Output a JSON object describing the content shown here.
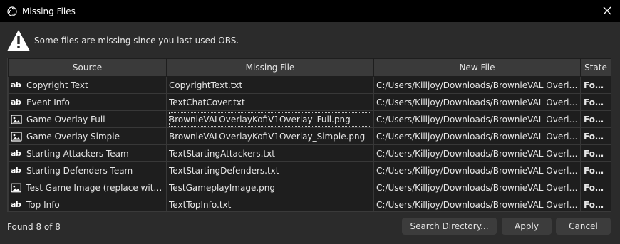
{
  "window": {
    "title": "Missing Files",
    "close_icon": "close-icon"
  },
  "warning": {
    "icon": "warning-icon",
    "text": "Some files are missing since you last used OBS."
  },
  "table": {
    "headers": [
      "Source",
      "Missing File",
      "New File",
      "State"
    ],
    "rows": [
      {
        "type": "text",
        "source": "Copyright Text",
        "missing": "CopyrightText.txt",
        "new": "C:/Users/Killjoy/Downloads/BrownieVAL Overlays K...",
        "state": "Found"
      },
      {
        "type": "text",
        "source": "Event Info",
        "missing": "TextChatCover.txt",
        "new": "C:/Users/Killjoy/Downloads/BrownieVAL Overlays K...",
        "state": "Found"
      },
      {
        "type": "image",
        "source": "Game Overlay Full",
        "missing": "BrownieVALOverlayKofiV1Overlay_Full.png",
        "new": "C:/Users/Killjoy/Downloads/BrownieVAL Overlays K...",
        "state": "Found"
      },
      {
        "type": "image",
        "source": "Game Overlay Simple",
        "missing": "BrownieVALOverlayKofiV1Overlay_Simple.png",
        "new": "C:/Users/Killjoy/Downloads/BrownieVAL Overlays K...",
        "state": "Found"
      },
      {
        "type": "text",
        "source": "Starting Attackers Team",
        "missing": "TextStartingAttackers.txt",
        "new": "C:/Users/Killjoy/Downloads/BrownieVAL Overlays K...",
        "state": "Found"
      },
      {
        "type": "text",
        "source": "Starting Defenders Team",
        "missing": "TextStartingDefenders.txt",
        "new": "C:/Users/Killjoy/Downloads/BrownieVAL Overlays K...",
        "state": "Found"
      },
      {
        "type": "image",
        "source": "Test Game Image (replace with ...",
        "missing": "TestGameplayImage.png",
        "new": "C:/Users/Killjoy/Downloads/BrownieVAL Overlays K...",
        "state": "Found"
      },
      {
        "type": "text",
        "source": "Top Info",
        "missing": "TextTopInfo.txt",
        "new": "C:/Users/Killjoy/Downloads/BrownieVAL Overlays K...",
        "state": "Found"
      }
    ]
  },
  "footer": {
    "status": "Found 8 of 8",
    "search_label": "Search Directory...",
    "apply_label": "Apply",
    "cancel_label": "Cancel"
  },
  "colors": {
    "background": "#2b2b2b",
    "titlebar": "#000000",
    "table_bg": "#1e1e1e",
    "header_bg": "#3a3a3a",
    "button_bg": "#3c3c3c"
  }
}
